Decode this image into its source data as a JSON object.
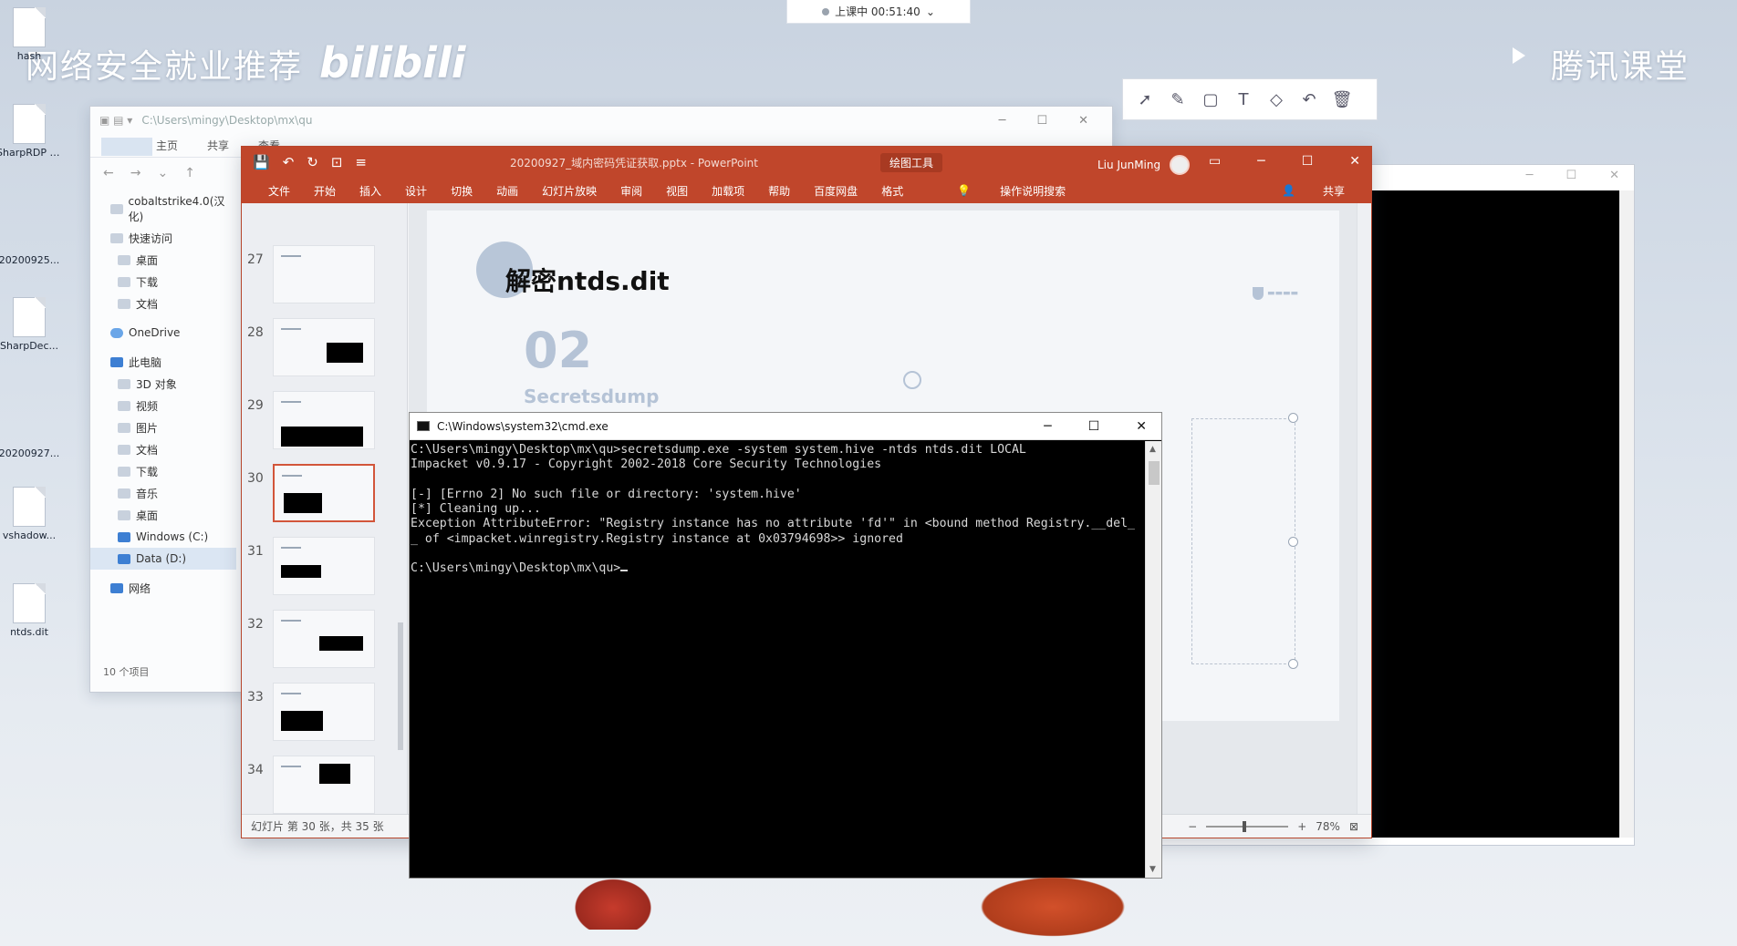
{
  "desktop": {
    "promo_text": "网络安全就业推荐",
    "promo_brand": "bilibili",
    "tencent_label": "腾讯课堂",
    "icons": [
      {
        "label": "hash"
      },
      {
        "label": "SharpRDP C..."
      },
      {
        "label": "20200925..."
      },
      {
        "label": "SharpDec..."
      },
      {
        "label": "20200927..."
      },
      {
        "label": "vshadow..."
      },
      {
        "label": "ntds.dit"
      }
    ]
  },
  "live_status": {
    "label": "上课中 00:51:40",
    "chevron": "⌄"
  },
  "drawing_toolbar": {
    "tools": [
      "select-arrow-icon",
      "pen-icon",
      "rectangle-icon",
      "text-icon",
      "eraser-icon",
      "undo-icon",
      "trash-icon"
    ]
  },
  "explorer": {
    "path": "C:\\Users\\mingy\\Desktop\\mx\\qu",
    "ribbon_tabs": [
      "主页",
      "共享",
      "查看"
    ],
    "tree": [
      {
        "label": "cobaltstrike4.0(汉化)",
        "kind": "folder",
        "level": 0
      },
      {
        "label": "快速访问",
        "kind": "star",
        "level": 0
      },
      {
        "label": "桌面",
        "kind": "folder",
        "level": 1
      },
      {
        "label": "下载",
        "kind": "folder",
        "level": 1
      },
      {
        "label": "文档",
        "kind": "folder",
        "level": 1
      },
      {
        "label": "OneDrive",
        "kind": "cloud",
        "level": 0
      },
      {
        "label": "此电脑",
        "kind": "pc",
        "level": 0
      },
      {
        "label": "3D 对象",
        "kind": "folder",
        "level": 1
      },
      {
        "label": "视频",
        "kind": "folder",
        "level": 1
      },
      {
        "label": "图片",
        "kind": "folder",
        "level": 1
      },
      {
        "label": "文档",
        "kind": "folder",
        "level": 1
      },
      {
        "label": "下载",
        "kind": "folder",
        "level": 1
      },
      {
        "label": "音乐",
        "kind": "folder",
        "level": 1
      },
      {
        "label": "桌面",
        "kind": "folder",
        "level": 1
      },
      {
        "label": "Windows (C:)",
        "kind": "drive",
        "level": 1
      },
      {
        "label": "Data (D:)",
        "kind": "drive",
        "level": 1,
        "selected": true
      },
      {
        "label": "网络",
        "kind": "network",
        "level": 0
      }
    ],
    "status": "10 个项目"
  },
  "powerpoint": {
    "doc_title": "20200927_域内密码凭证获取.pptx  -  PowerPoint",
    "context_tab": "绘图工具",
    "user_name": "Liu JunMing",
    "tabs": [
      "文件",
      "开始",
      "插入",
      "设计",
      "切换",
      "动画",
      "幻灯片放映",
      "审阅",
      "视图",
      "加载项",
      "帮助",
      "百度网盘",
      "格式"
    ],
    "tell_me": "操作说明搜索",
    "share": "共享",
    "thumbnails": [
      {
        "num": "27"
      },
      {
        "num": "28"
      },
      {
        "num": "29"
      },
      {
        "num": "30",
        "selected": true
      },
      {
        "num": "31"
      },
      {
        "num": "32"
      },
      {
        "num": "33"
      },
      {
        "num": "34"
      }
    ],
    "slide": {
      "heading": "解密ntds.dit",
      "number": "02",
      "subtitle": "Secretsdump"
    },
    "status_left": "幻灯片 第 30 张，共 35 张",
    "zoom": "78%"
  },
  "cmd": {
    "title": "C:\\Windows\\system32\\cmd.exe",
    "lines": [
      "C:\\Users\\mingy\\Desktop\\mx\\qu>secretsdump.exe -system system.hive -ntds ntds.dit LOCAL",
      "Impacket v0.9.17 - Copyright 2002-2018 Core Security Technologies",
      "",
      "[-] [Errno 2] No such file or directory: 'system.hive'",
      "[*] Cleaning up...",
      "Exception AttributeError: \"Registry instance has no attribute 'fd'\" in <bound method Registry.__del_",
      "_ of <impacket.winregistry.Registry instance at 0x03794698>> ignored",
      "",
      "C:\\Users\\mingy\\Desktop\\mx\\qu>"
    ]
  }
}
